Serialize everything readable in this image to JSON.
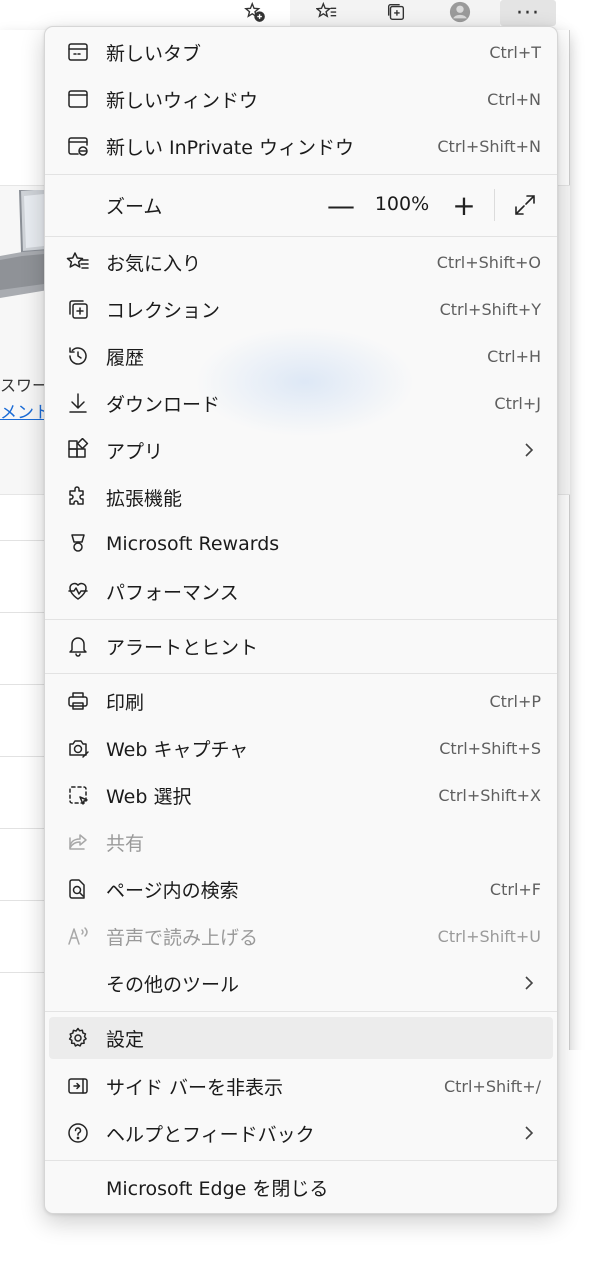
{
  "background": {
    "partial_text_1": "スワー",
    "partial_link": "メント"
  },
  "toolbar": {
    "more_label": "···"
  },
  "menu": {
    "new_tab": {
      "label": "新しいタブ",
      "shortcut": "Ctrl+T"
    },
    "new_window": {
      "label": "新しいウィンドウ",
      "shortcut": "Ctrl+N"
    },
    "new_inprivate": {
      "label": "新しい InPrivate ウィンドウ",
      "shortcut": "Ctrl+Shift+N"
    },
    "zoom": {
      "label": "ズーム",
      "minus": "—",
      "value": "100%",
      "plus": "+"
    },
    "favorites": {
      "label": "お気に入り",
      "shortcut": "Ctrl+Shift+O"
    },
    "collections": {
      "label": "コレクション",
      "shortcut": "Ctrl+Shift+Y"
    },
    "history": {
      "label": "履歴",
      "shortcut": "Ctrl+H"
    },
    "downloads": {
      "label": "ダウンロード",
      "shortcut": "Ctrl+J"
    },
    "apps": {
      "label": "アプリ"
    },
    "extensions": {
      "label": "拡張機能"
    },
    "rewards": {
      "label": "Microsoft Rewards"
    },
    "performance": {
      "label": "パフォーマンス"
    },
    "alerts": {
      "label": "アラートとヒント"
    },
    "print": {
      "label": "印刷",
      "shortcut": "Ctrl+P"
    },
    "web_capture": {
      "label": "Web キャプチャ",
      "shortcut": "Ctrl+Shift+S"
    },
    "web_select": {
      "label": "Web 選択",
      "shortcut": "Ctrl+Shift+X"
    },
    "share": {
      "label": "共有"
    },
    "find": {
      "label": "ページ内の検索",
      "shortcut": "Ctrl+F"
    },
    "read_aloud": {
      "label": "音声で読み上げる",
      "shortcut": "Ctrl+Shift+U"
    },
    "more_tools": {
      "label": "その他のツール"
    },
    "settings": {
      "label": "設定"
    },
    "hide_sidebar": {
      "label": "サイド バーを非表示",
      "shortcut": "Ctrl+Shift+/"
    },
    "help": {
      "label": "ヘルプとフィードバック"
    },
    "close_edge": {
      "label": "Microsoft Edge を閉じる"
    }
  }
}
